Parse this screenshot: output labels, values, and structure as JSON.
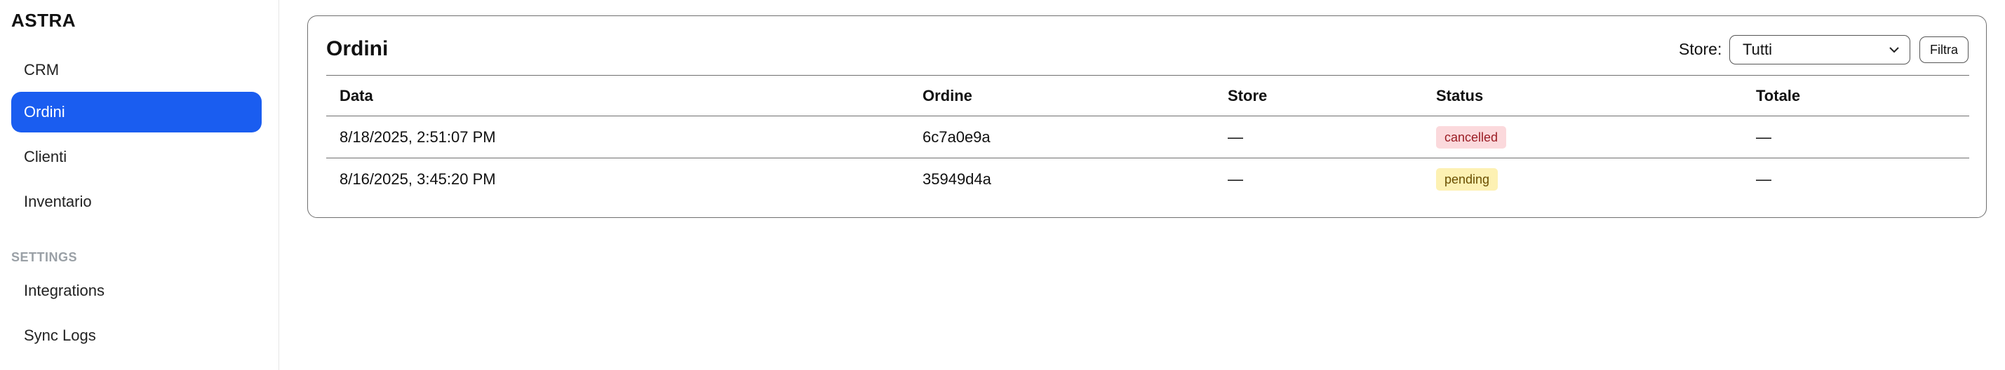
{
  "sidebar": {
    "brand": "ASTRA",
    "nav_items": [
      {
        "label": "CRM"
      },
      {
        "label": "Ordini",
        "active": true
      },
      {
        "label": "Clienti"
      },
      {
        "label": "Inventario"
      }
    ],
    "settings_label": "SETTINGS",
    "settings_items": [
      {
        "label": "Integrations"
      },
      {
        "label": "Sync Logs"
      }
    ]
  },
  "main": {
    "title": "Ordini",
    "filter": {
      "label": "Store:",
      "selected": "Tutti",
      "button_label": "Filtra"
    },
    "table": {
      "columns": [
        "Data",
        "Ordine",
        "Store",
        "Status",
        "Totale"
      ],
      "rows": [
        {
          "data": "8/18/2025, 2:51:07 PM",
          "ordine": "6c7a0e9a",
          "store": "—",
          "status": "cancelled",
          "totale": "—"
        },
        {
          "data": "8/16/2025, 3:45:20 PM",
          "ordine": "35949d4a",
          "store": "—",
          "status": "pending",
          "totale": "—"
        }
      ]
    }
  },
  "colors": {
    "accent": "#1a5df0",
    "cancelled_bg": "#fbd9dc",
    "pending_bg": "#fdf1b3"
  },
  "icons": {
    "select_chevron": "chevron-down-icon"
  }
}
